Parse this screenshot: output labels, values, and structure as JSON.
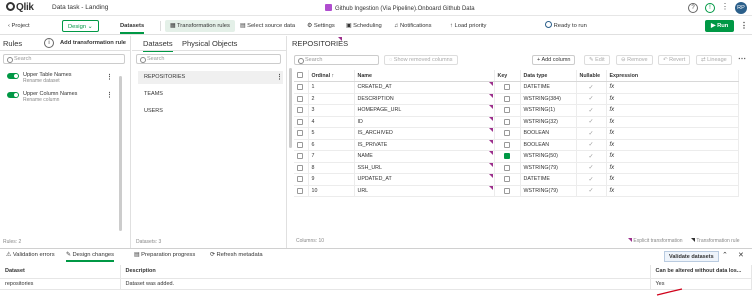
{
  "topbar": {
    "logo": "Qlik",
    "app_title": "Data task - Landing",
    "pipeline": "Github Ingestion (Via Pipeline).Onboard Github Data",
    "avatar": "RP"
  },
  "toolbar": {
    "project": "Project",
    "design": "Design",
    "datasets": "Datasets",
    "transformation_rules": "Transformation rules",
    "select_source_data": "Select source data",
    "settings": "Settings",
    "scheduling": "Scheduling",
    "notifications": "Notifications",
    "load_priority": "Load priority",
    "ready_to_run": "Ready to run",
    "run": "Run"
  },
  "rules": {
    "title": "Rules",
    "add_button": "Add transformation rule",
    "search_placeholder": "Search",
    "items": [
      {
        "name": "Upper Table Names",
        "sub": "Rename dataset"
      },
      {
        "name": "Upper Column Names",
        "sub": "Rename column"
      }
    ],
    "footer": "Rules: 2"
  },
  "datasets": {
    "tab_datasets": "Datasets",
    "tab_physical": "Physical Objects",
    "search_placeholder": "Search",
    "items": [
      "REPOSITORIES",
      "TEAMS",
      "USERS"
    ],
    "footer": "Datasets: 3"
  },
  "repo": {
    "title": "REPOSITORIES",
    "search_placeholder": "Search",
    "show_removed": "Show removed columns",
    "add_column": "Add column",
    "edit": "Edit",
    "remove": "Remove",
    "revert": "Revert",
    "lineage": "Lineage",
    "columns": [
      "Ordinal",
      "Name",
      "Key",
      "Data type",
      "Nullable",
      "Expression"
    ],
    "rows": [
      {
        "ordinal": "1",
        "name": "CREATED_AT",
        "type": "DATETIME"
      },
      {
        "ordinal": "2",
        "name": "DESCRIPTION",
        "type": "WSTRING(384)"
      },
      {
        "ordinal": "3",
        "name": "HOMEPAGE_URL",
        "type": "WSTRING(1)"
      },
      {
        "ordinal": "4",
        "name": "ID",
        "type": "WSTRING(32)"
      },
      {
        "ordinal": "5",
        "name": "IS_ARCHIVED",
        "type": "BOOLEAN"
      },
      {
        "ordinal": "6",
        "name": "IS_PRIVATE",
        "type": "BOOLEAN"
      },
      {
        "ordinal": "7",
        "name": "NAME",
        "type": "WSTRING(50)"
      },
      {
        "ordinal": "8",
        "name": "SSH_URL",
        "type": "WSTRING(79)"
      },
      {
        "ordinal": "9",
        "name": "UPDATED_AT",
        "type": "DATETIME"
      },
      {
        "ordinal": "10",
        "name": "URL",
        "type": "WSTRING(79)"
      }
    ],
    "footer": "Columns: 10",
    "legend_explicit": "Explicit transformation",
    "legend_rule": "Transformation rule"
  },
  "bottom": {
    "tabs": [
      "Validation errors",
      "Design changes",
      "Preparation progress",
      "Refresh metadata"
    ],
    "validate": "Validate datasets",
    "headers": [
      "Dataset",
      "Description",
      "Can be altered without data los..."
    ],
    "rows": [
      {
        "dataset": "repositories",
        "description": "Dataset was added.",
        "alter": "Yes"
      }
    ]
  },
  "colors": {
    "accent": "#009845",
    "marker": "#9c2f8c",
    "pipeline": "#b04dcf"
  }
}
